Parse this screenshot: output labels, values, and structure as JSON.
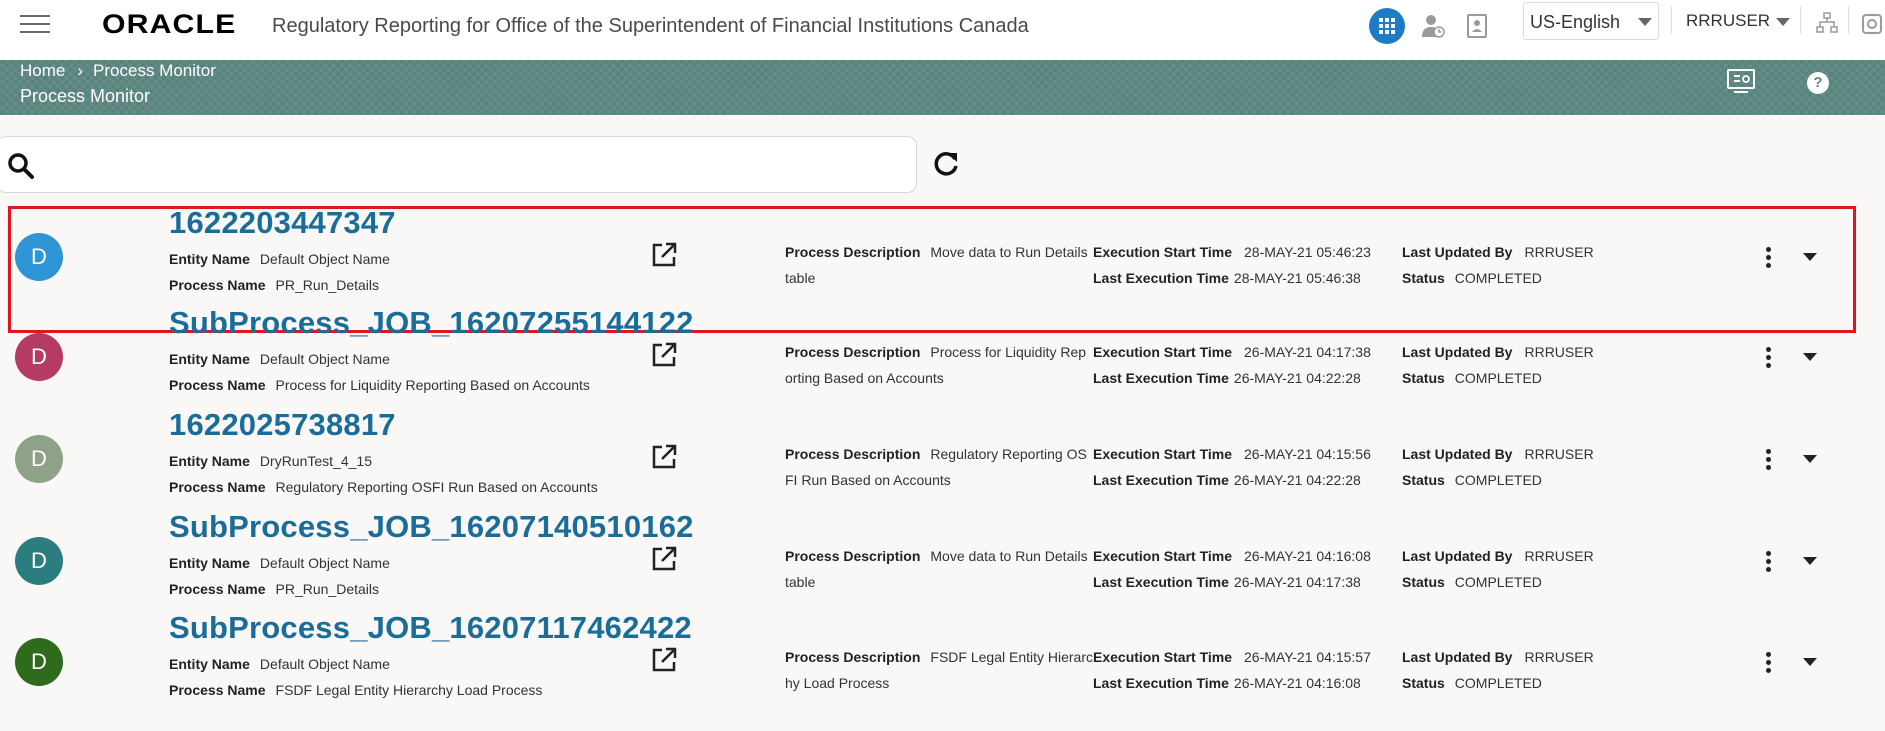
{
  "header": {
    "logo_text": "ORACLE",
    "app_title": "Regulatory Reporting for Office of the Superintendent of Financial Institutions Canada",
    "language": "US-English",
    "user": "RRRUSER",
    "icons": [
      "menu-icon",
      "apps-grid-icon",
      "user-task-icon",
      "badge-icon",
      "hierarchy-icon",
      "edge-icon"
    ]
  },
  "breadcrumb": {
    "home": "Home",
    "current": "Process Monitor"
  },
  "page_title": "Process Monitor",
  "banner_icons": {
    "help": "?"
  },
  "search": {
    "placeholder": "",
    "value": ""
  },
  "labels": {
    "entity_name": "Entity Name",
    "process_name": "Process Name",
    "process_description": "Process Description",
    "execution_start_time": "Execution Start Time",
    "last_execution_time": "Last Execution Time",
    "last_updated_by": "Last Updated By",
    "status": "Status"
  },
  "processes": [
    {
      "avatar": "D",
      "avatar_color": "#2f95d6",
      "id": "1622203447347",
      "entity_name": "Default Object Name",
      "process_name": "PR_Run_Details",
      "description_line1": "Move data to Run Details",
      "description_line2": "table",
      "execution_start": "28-MAY-21 05:46:23",
      "last_execution": "28-MAY-21 05:46:38",
      "updated_by": "RRRUSER",
      "status": "COMPLETED",
      "highlighted": true
    },
    {
      "avatar": "D",
      "avatar_color": "#b63b62",
      "id": "SubProcess_JOB_16207255144122",
      "entity_name": "Default Object Name",
      "process_name": "Process for Liquidity Reporting Based on Accounts",
      "description_line1": "Process for Liquidity Rep",
      "description_line2": "orting Based on Accounts",
      "execution_start": "26-MAY-21 04:17:38",
      "last_execution": "26-MAY-21 04:22:28",
      "updated_by": "RRRUSER",
      "status": "COMPLETED",
      "highlighted": false
    },
    {
      "avatar": "D",
      "avatar_color": "#8ea288",
      "id": "1622025738817",
      "entity_name": "DryRunTest_4_15",
      "process_name": "Regulatory Reporting OSFI Run Based on Accounts",
      "description_line1": "Regulatory Reporting OS",
      "description_line2": "FI Run Based on Accounts",
      "execution_start": "26-MAY-21 04:15:56",
      "last_execution": "26-MAY-21 04:22:28",
      "updated_by": "RRRUSER",
      "status": "COMPLETED",
      "highlighted": false
    },
    {
      "avatar": "D",
      "avatar_color": "#2c7d80",
      "id": "SubProcess_JOB_16207140510162",
      "entity_name": "Default Object Name",
      "process_name": "PR_Run_Details",
      "description_line1": "Move data to Run Details",
      "description_line2": "table",
      "execution_start": "26-MAY-21 04:16:08",
      "last_execution": "26-MAY-21 04:17:38",
      "updated_by": "RRRUSER",
      "status": "COMPLETED",
      "highlighted": false
    },
    {
      "avatar": "D",
      "avatar_color": "#2f6b1c",
      "id": "SubProcess_JOB_16207117462422",
      "entity_name": "Default Object Name",
      "process_name": "FSDF Legal Entity Hierarchy Load Process",
      "description_line1": "FSDF Legal Entity Hierarc",
      "description_line2": "hy Load Process",
      "execution_start": "26-MAY-21 04:15:57",
      "last_execution": "26-MAY-21 04:16:08",
      "updated_by": "RRRUSER",
      "status": "COMPLETED",
      "highlighted": false
    }
  ]
}
